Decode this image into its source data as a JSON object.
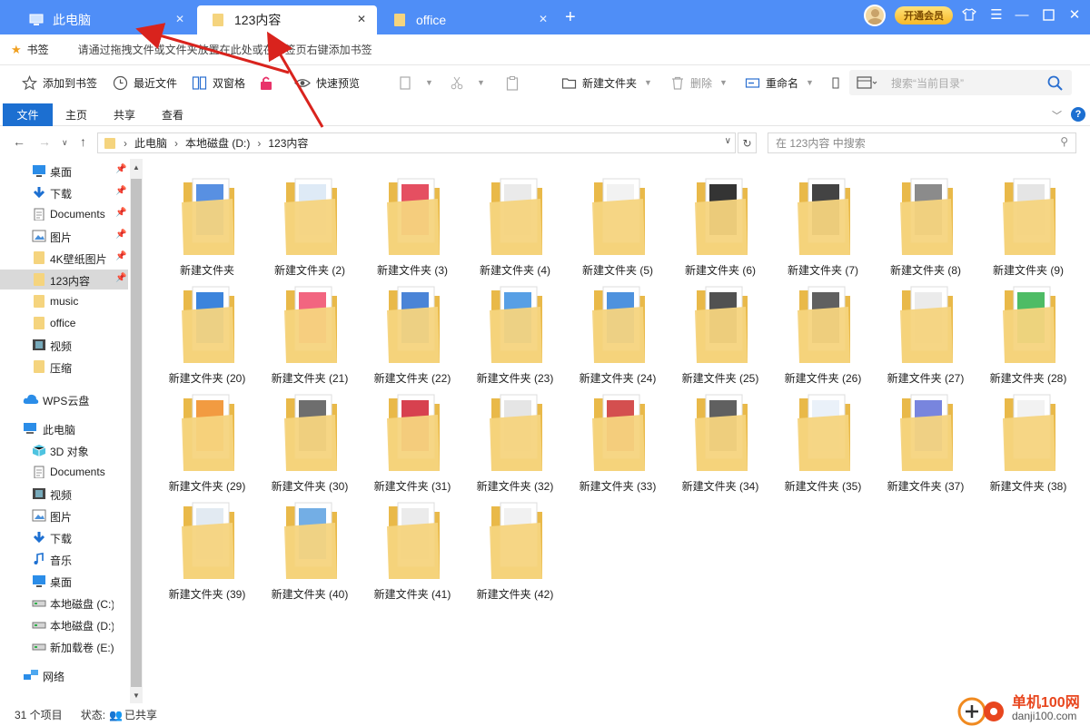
{
  "tabs": [
    {
      "label": "此电脑",
      "icon": "computer-icon",
      "active": false
    },
    {
      "label": "123内容",
      "icon": "folder-icon",
      "active": true
    },
    {
      "label": "office",
      "icon": "folder-icon",
      "active": false
    }
  ],
  "header": {
    "vip_label": "开通会员"
  },
  "bookmarks": {
    "label": "书签",
    "hint": "请通过拖拽文件或文件夹放置在此处或在标签页右键添加书签"
  },
  "toolbar": {
    "add_bookmark": "添加到书签",
    "recent_files": "最近文件",
    "dual_pane": "双窗格",
    "quick_preview": "快速预览",
    "new_folder": "新建文件夹",
    "delete": "删除",
    "rename": "重命名",
    "search_placeholder": "搜索“当前目录”"
  },
  "ribbon": {
    "tabs": [
      "文件",
      "主页",
      "共享",
      "查看"
    ]
  },
  "address": {
    "path": [
      "此电脑",
      "本地磁盘 (D:)",
      "123内容"
    ],
    "search_placeholder": "在 123内容 中搜索"
  },
  "sidebar": {
    "quick_access": [
      {
        "label": "桌面",
        "icon": "desktop-icon",
        "pinned": true
      },
      {
        "label": "下载",
        "icon": "download-icon",
        "pinned": true
      },
      {
        "label": "Documents",
        "icon": "document-icon",
        "pinned": true
      },
      {
        "label": "图片",
        "icon": "picture-icon",
        "pinned": true
      },
      {
        "label": "4K壁纸图片",
        "icon": "folder-icon",
        "pinned": true
      },
      {
        "label": "123内容",
        "icon": "folder-icon",
        "pinned": true,
        "selected": true
      },
      {
        "label": "music",
        "icon": "folder-icon",
        "pinned": false
      },
      {
        "label": "office",
        "icon": "folder-icon",
        "pinned": false
      },
      {
        "label": "视频",
        "icon": "video-icon",
        "pinned": false
      },
      {
        "label": "压缩",
        "icon": "folder-icon",
        "pinned": false
      }
    ],
    "wps": {
      "label": "WPS云盘",
      "icon": "cloud-icon"
    },
    "this_pc": {
      "label": "此电脑",
      "icon": "computer-icon"
    },
    "pc_items": [
      {
        "label": "3D 对象",
        "icon": "cube-icon"
      },
      {
        "label": "Documents",
        "icon": "document-icon"
      },
      {
        "label": "视频",
        "icon": "video-icon"
      },
      {
        "label": "图片",
        "icon": "picture-icon"
      },
      {
        "label": "下载",
        "icon": "download-icon"
      },
      {
        "label": "音乐",
        "icon": "music-icon"
      },
      {
        "label": "桌面",
        "icon": "desktop-icon"
      },
      {
        "label": "本地磁盘 (C:)",
        "icon": "drive-icon"
      },
      {
        "label": "本地磁盘 (D:)",
        "icon": "drive-icon"
      },
      {
        "label": "新加载卷 (E:)",
        "icon": "drive-icon"
      }
    ],
    "network": {
      "label": "网络",
      "icon": "network-icon"
    }
  },
  "folders": [
    {
      "name": "新建文件夹",
      "preview": "#3b7ddd"
    },
    {
      "name": "新建文件夹 (2)",
      "preview": "#d8e6f5"
    },
    {
      "name": "新建文件夹 (3)",
      "preview": "#e03045"
    },
    {
      "name": "新建文件夹 (4)",
      "preview": "#e6e6e6"
    },
    {
      "name": "新建文件夹 (5)",
      "preview": "#f0f0f0"
    },
    {
      "name": "新建文件夹 (6)",
      "preview": "#111111"
    },
    {
      "name": "新建文件夹 (7)",
      "preview": "#222222"
    },
    {
      "name": "新建文件夹 (8)",
      "preview": "#777777"
    },
    {
      "name": "新建文件夹 (9)",
      "preview": "#e0e0e0"
    },
    {
      "name": "新建文件夹 (20)",
      "preview": "#1a6fd6"
    },
    {
      "name": "新建文件夹 (21)",
      "preview": "#f04a6a"
    },
    {
      "name": "新建文件夹 (22)",
      "preview": "#2a6fd0"
    },
    {
      "name": "新建文件夹 (23)",
      "preview": "#3a8ee0"
    },
    {
      "name": "新建文件夹 (24)",
      "preview": "#2f7fd8"
    },
    {
      "name": "新建文件夹 (25)",
      "preview": "#333333"
    },
    {
      "name": "新建文件夹 (26)",
      "preview": "#444444"
    },
    {
      "name": "新建文件夹 (27)",
      "preview": "#e8e8e8"
    },
    {
      "name": "新建文件夹 (28)",
      "preview": "#2fb04a"
    },
    {
      "name": "新建文件夹 (29)",
      "preview": "#f08a20"
    },
    {
      "name": "新建文件夹 (30)",
      "preview": "#555555"
    },
    {
      "name": "新建文件夹 (31)",
      "preview": "#d02030"
    },
    {
      "name": "新建文件夹 (32)",
      "preview": "#e0e0e0"
    },
    {
      "name": "新建文件夹 (33)",
      "preview": "#cc3030"
    },
    {
      "name": "新建文件夹 (34)",
      "preview": "#444444"
    },
    {
      "name": "新建文件夹 (35)",
      "preview": "#e6eef8"
    },
    {
      "name": "新建文件夹 (37)",
      "preview": "#6070d8"
    },
    {
      "name": "新建文件夹 (38)",
      "preview": "#f0f0f0"
    },
    {
      "name": "新建文件夹 (39)",
      "preview": "#dde6f0"
    },
    {
      "name": "新建文件夹 (40)",
      "preview": "#5aa0e0"
    },
    {
      "name": "新建文件夹 (41)",
      "preview": "#e8e8e8"
    },
    {
      "name": "新建文件夹 (42)",
      "preview": "#eeeeee"
    }
  ],
  "status": {
    "count": "31 个项目",
    "state_label": "状态:",
    "state_value": "已共享"
  },
  "watermark": {
    "text": "单机100网",
    "sub": "danji100.com"
  },
  "colors": {
    "accent": "#4f8ef7",
    "ribbon_file": "#1c6fd1",
    "folder": "#f5d47e",
    "arrow": "#d9231d"
  }
}
